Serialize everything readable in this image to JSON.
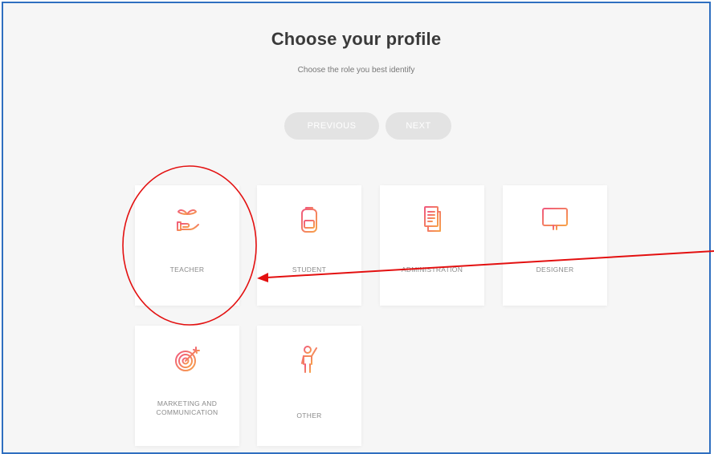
{
  "header": {
    "title": "Choose your profile",
    "subtitle": "Choose the role you best identify"
  },
  "navigation": {
    "previous_label": "PREVIOUS",
    "next_label": "NEXT"
  },
  "profiles": [
    {
      "label": "TEACHER",
      "icon": "plant-hand-icon"
    },
    {
      "label": "STUDENT",
      "icon": "backpack-icon"
    },
    {
      "label": "ADMINISTRATION",
      "icon": "documents-icon"
    },
    {
      "label": "DESIGNER",
      "icon": "monitor-icon"
    },
    {
      "label": "MARKETING AND COMMUNICATION",
      "icon": "target-icon"
    },
    {
      "label": "OTHER",
      "icon": "person-waving-icon"
    }
  ],
  "colors": {
    "icon_gradient_start": "#f05a7e",
    "icon_gradient_end": "#f7a14a",
    "annotation": "#e31010",
    "frame_border": "#2f6fc0"
  }
}
